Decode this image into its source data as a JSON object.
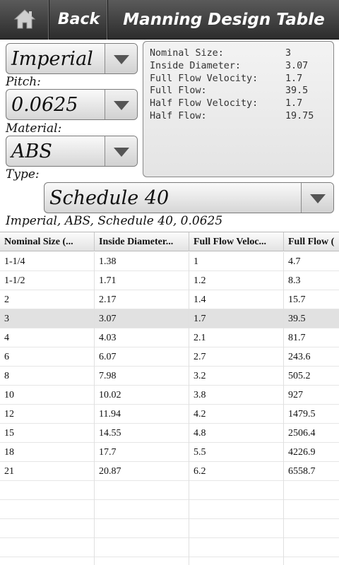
{
  "header": {
    "home_icon": "home-icon",
    "back_label": "Back",
    "title": "Manning Design Table"
  },
  "controls": {
    "units": "Imperial",
    "pitch_label": "Pitch:",
    "pitch": "0.0625",
    "material_label": "Material:",
    "material": "ABS",
    "type_label": "Type:",
    "type": "Schedule 40"
  },
  "info": [
    {
      "key": "Nominal Size:",
      "value": "3"
    },
    {
      "key": "Inside Diameter:",
      "value": "3.07"
    },
    {
      "key": "Full Flow Velocity:",
      "value": "1.7"
    },
    {
      "key": "Full Flow:",
      "value": "39.5"
    },
    {
      "key": "Half Flow Velocity:",
      "value": "1.7"
    },
    {
      "key": "Half Flow:",
      "value": "19.75"
    }
  ],
  "summary": "Imperial, ABS, Schedule 40, 0.0625",
  "table": {
    "headers": [
      "Nominal Size (...",
      "Inside Diameter...",
      "Full Flow Veloc...",
      "Full Flow ("
    ],
    "selected_row": 3,
    "rows": [
      [
        "1-1/4",
        "1.38",
        "1",
        "4.7"
      ],
      [
        "1-1/2",
        "1.71",
        "1.2",
        "8.3"
      ],
      [
        "2",
        "2.17",
        "1.4",
        "15.7"
      ],
      [
        "3",
        "3.07",
        "1.7",
        "39.5"
      ],
      [
        "4",
        "4.03",
        "2.1",
        "81.7"
      ],
      [
        "6",
        "6.07",
        "2.7",
        "243.6"
      ],
      [
        "8",
        "7.98",
        "3.2",
        "505.2"
      ],
      [
        "10",
        "10.02",
        "3.8",
        "927"
      ],
      [
        "12",
        "11.94",
        "4.2",
        "1479.5"
      ],
      [
        "15",
        "14.55",
        "4.8",
        "2506.4"
      ],
      [
        "18",
        "17.7",
        "5.5",
        "4226.9"
      ],
      [
        "21",
        "20.87",
        "6.2",
        "6558.7"
      ]
    ]
  },
  "colors": {
    "toolbar": "#3a3a3a",
    "selected_row": "#e1e1e1"
  }
}
